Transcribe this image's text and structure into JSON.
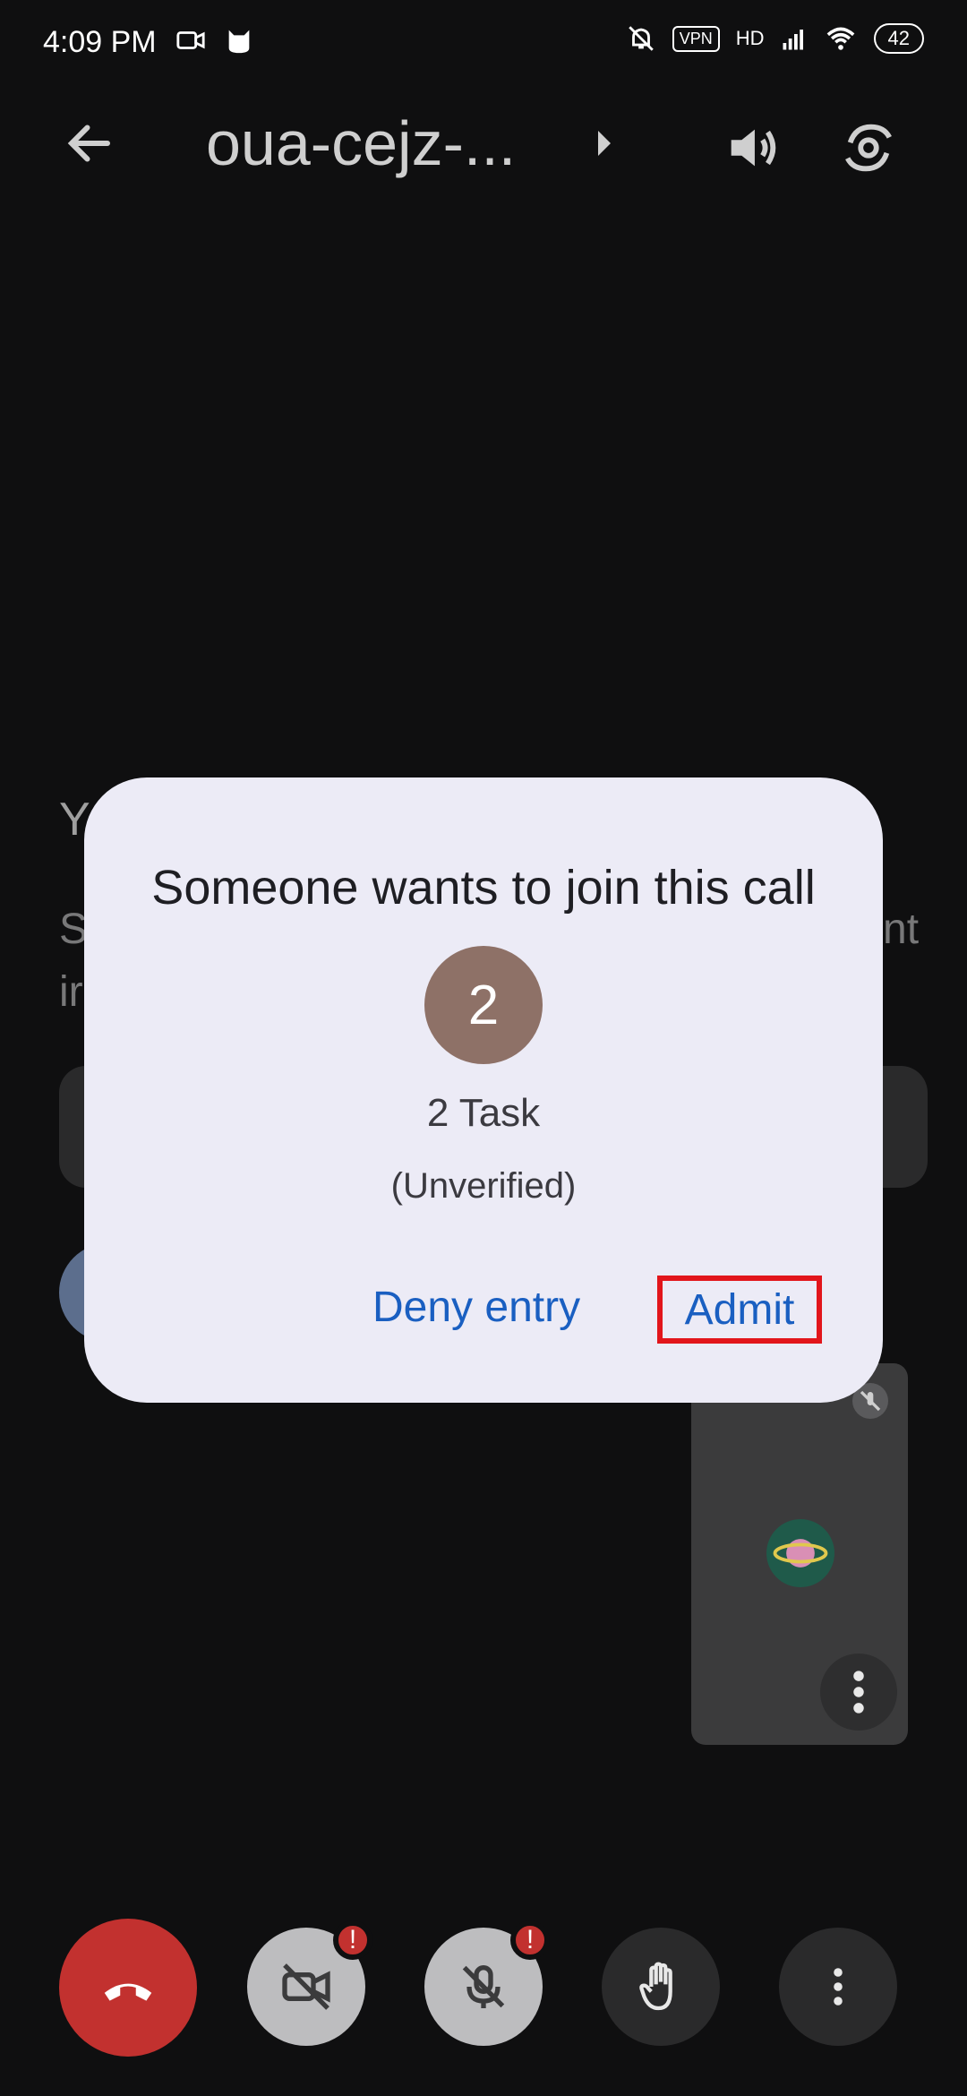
{
  "status_bar": {
    "time": "4:09 PM",
    "vpn": "VPN",
    "network": "HD",
    "battery": "42"
  },
  "app_bar": {
    "title": "oua-cejz-..."
  },
  "background": {
    "heading_partial": "Y",
    "line1_partial": "S",
    "line2_partial": "ir",
    "line1_end_partial": "nt"
  },
  "dialog": {
    "title": "Someone wants to join this call",
    "avatar_initial": "2",
    "name": "2 Task",
    "subtitle": "(Unverified)",
    "deny_label": "Deny entry",
    "admit_label": "Admit"
  },
  "controls": {
    "cam_badge": "!",
    "mic_badge": "!"
  },
  "colors": {
    "accent_blue": "#1a5fc1",
    "hangup_red": "#c2312f",
    "dialog_bg": "#ecebf6",
    "highlight_red": "#e2151b"
  }
}
